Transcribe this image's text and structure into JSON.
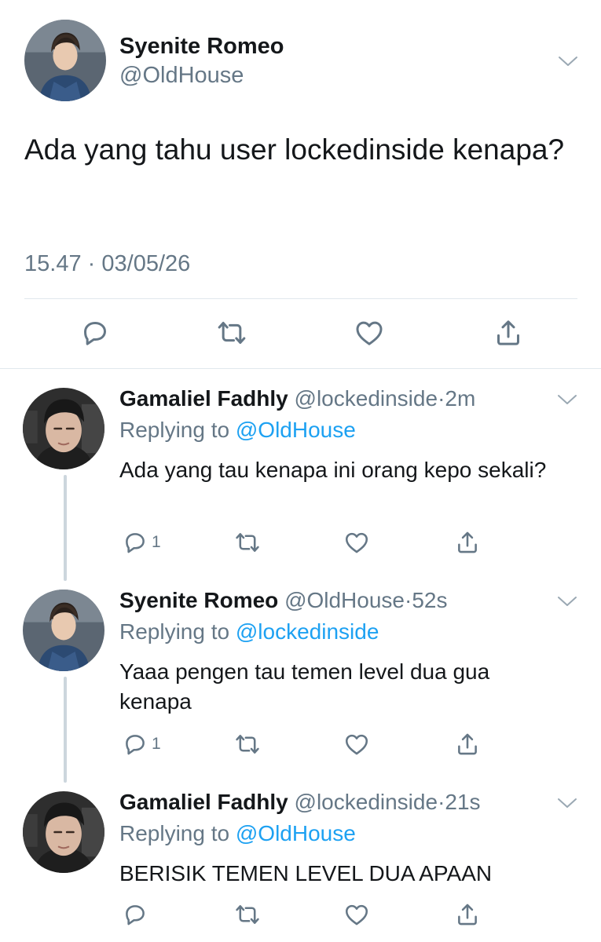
{
  "main_tweet": {
    "author_name": "Syenite Romeo",
    "author_handle": "@OldHouse",
    "text": "Ada yang tahu user lockedinside kenapa?",
    "time": "15.47",
    "dot": "·",
    "date": "03/05/26",
    "icons": [
      "reply-icon",
      "retweet-icon",
      "like-icon",
      "share-icon"
    ]
  },
  "replies": [
    {
      "author_name": "Gamaliel Fadhly",
      "author_handle": "@lockedinside",
      "dot": "·",
      "age": "2m",
      "replying_prefix": "Replying to",
      "replying_to": "@OldHouse",
      "text": "Ada yang tau kenapa ini orang kepo sekali?",
      "reply_count": "1"
    },
    {
      "author_name": "Syenite Romeo",
      "author_handle": "@OldHouse",
      "dot": "·",
      "age": "52s",
      "replying_prefix": "Replying to",
      "replying_to": "@lockedinside",
      "text": "Yaaa pengen tau temen level dua gua kenapa",
      "reply_count": "1"
    },
    {
      "author_name": "Gamaliel Fadhly",
      "author_handle": "@lockedinside",
      "dot": "·",
      "age": "21s",
      "replying_prefix": "Replying to",
      "replying_to": "@OldHouse",
      "text": "BERISIK TEMEN LEVEL DUA APAAN",
      "reply_count": ""
    }
  ],
  "colors": {
    "text": "#14171a",
    "secondary": "#657786",
    "link": "#1da1f2",
    "separator": "#e1e8ed",
    "thread_line": "#ccd6dd"
  }
}
